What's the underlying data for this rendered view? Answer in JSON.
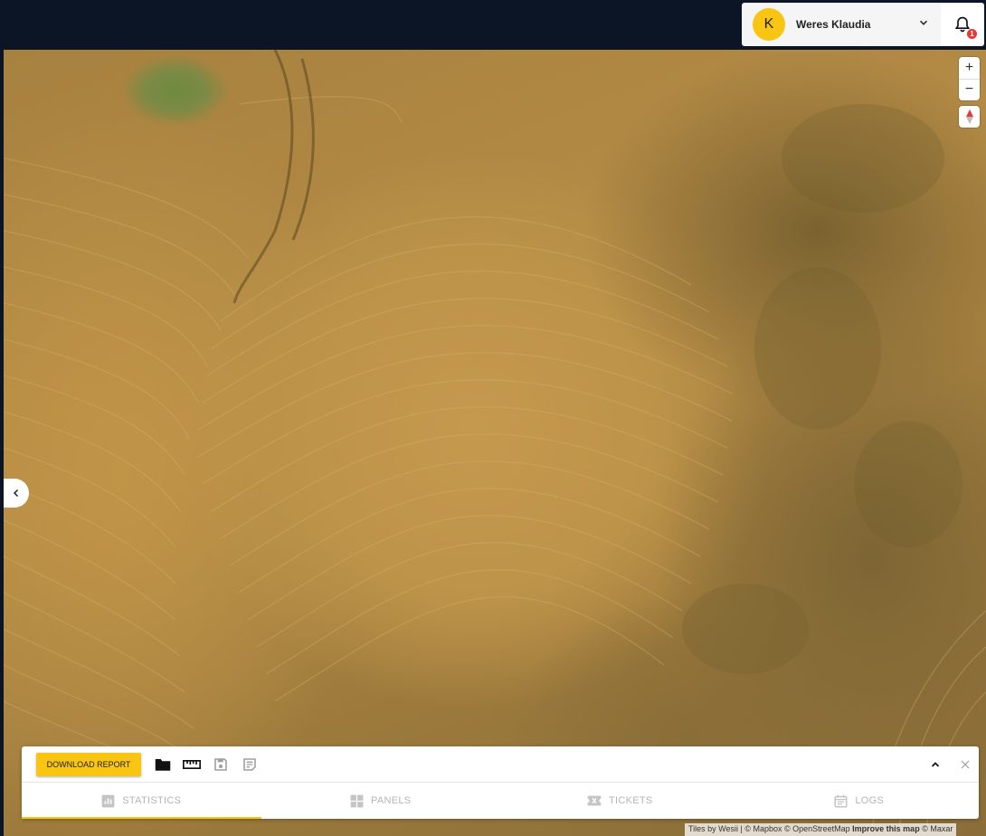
{
  "user": {
    "avatar_initial": "K",
    "name": "Weres Klaudia"
  },
  "notifications": {
    "count": "1"
  },
  "map": {
    "zoom_in": "+",
    "zoom_out": "−",
    "attribution": {
      "text": "Tiles by Wesii | © Mapbox © OpenStreetMap ",
      "improve": "Improve this map",
      "maxar": " © Maxar"
    }
  },
  "bottom_panel": {
    "download_label": "DOWNLOAD REPORT",
    "tabs": [
      {
        "label": "STATISTICS",
        "icon": "bar-chart-icon",
        "active": true
      },
      {
        "label": "PANELS",
        "icon": "grid-icon",
        "active": false
      },
      {
        "label": "TICKETS",
        "icon": "ticket-icon",
        "active": false
      },
      {
        "label": "LOGS",
        "icon": "calendar-icon",
        "active": false
      }
    ]
  },
  "colors": {
    "accent": "#f9c513",
    "topbar": "#0b1526",
    "badge": "#e53935"
  }
}
